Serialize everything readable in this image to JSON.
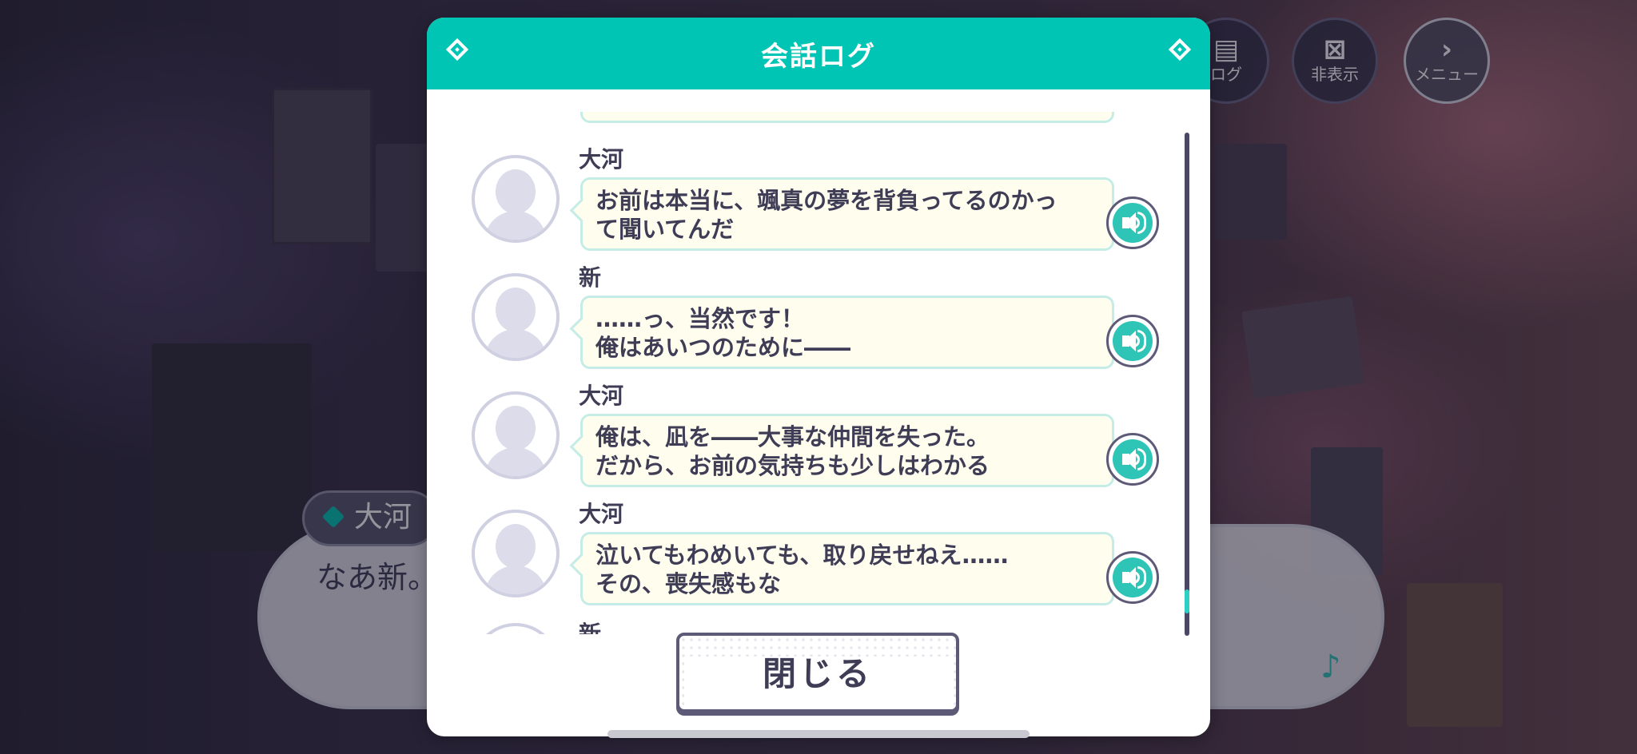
{
  "hud": {
    "log_label": "ログ",
    "hide_label": "非表示",
    "menu_label": "メニュー"
  },
  "dialogue": {
    "speaker": "大河",
    "text": "なあ新。"
  },
  "log_modal": {
    "title": "会話ログ",
    "entries": [
      {
        "speaker": "大河",
        "text": "お前は本当に、颯真の夢を背負ってるのかっ\nて聞いてんだ"
      },
      {
        "speaker": "新",
        "text": "……っ、当然です！\n俺はあいつのために――"
      },
      {
        "speaker": "大河",
        "text": "俺は、凪を――大事な仲間を失った。\nだから、お前の気持ちも少しはわかる"
      },
      {
        "speaker": "大河",
        "text": "泣いてもわめいても、取り戻せねえ……\nその、喪失感もな"
      }
    ],
    "partial_speaker": "新",
    "close_label": "閉じる"
  },
  "colors": {
    "accent": "#00c4b4",
    "text": "#3f3d56",
    "bubble": "#fffdee"
  }
}
